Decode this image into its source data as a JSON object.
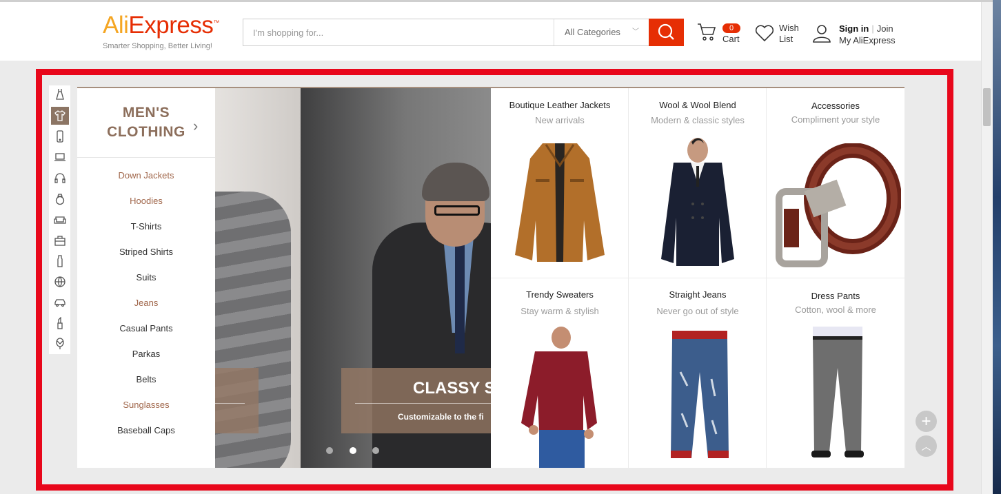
{
  "header": {
    "logo_ali": "Ali",
    "logo_express": "Express",
    "logo_tm": "™",
    "tagline": "Smarter Shopping, Better Living!",
    "search_placeholder": "I'm shopping for...",
    "category_select": "All Categories",
    "cart_count": "0",
    "cart_label": "Cart",
    "wish_line1": "Wish",
    "wish_line2": "List",
    "sign_in": "Sign in",
    "join": "Join",
    "my_account": "My AliExpress"
  },
  "category_rail": {
    "icons": [
      "dress-icon",
      "shirt-icon",
      "phone-icon",
      "laptop-icon",
      "headphones-icon",
      "ring-icon",
      "sofa-icon",
      "briefcase-icon",
      "bottle-icon",
      "ball-icon",
      "car-icon",
      "lipstick-icon",
      "balloon-icon"
    ],
    "active_index": 1
  },
  "category_panel": {
    "title_line1": "MEN'S",
    "title_line2": "CLOTHING",
    "items": [
      {
        "label": "Down Jackets",
        "highlight": true
      },
      {
        "label": "Hoodies",
        "highlight": true
      },
      {
        "label": "T-Shirts",
        "highlight": false
      },
      {
        "label": "Striped Shirts",
        "highlight": false
      },
      {
        "label": "Suits",
        "highlight": false
      },
      {
        "label": "Jeans",
        "highlight": true
      },
      {
        "label": "Casual Pants",
        "highlight": false
      },
      {
        "label": "Parkas",
        "highlight": false
      },
      {
        "label": "Belts",
        "highlight": false
      },
      {
        "label": "Sunglasses",
        "highlight": true
      },
      {
        "label": "Baseball Caps",
        "highlight": false
      }
    ]
  },
  "hero": {
    "caption_title": "CLASSY SU",
    "caption_sub": "Customizable to the fi",
    "slide_count": 3,
    "active_slide": 2
  },
  "products": [
    {
      "title": "Boutique Leather Jackets",
      "subtitle": "New arrivals",
      "icon": "jacket-image"
    },
    {
      "title": "Wool & Wool Blend",
      "subtitle": "Modern & classic styles",
      "icon": "coat-image"
    },
    {
      "title": "Accessories",
      "subtitle": "Compliment your style",
      "icon": "belt-image"
    },
    {
      "title": "Trendy Sweaters",
      "subtitle": "Stay warm & stylish",
      "icon": "sweater-image"
    },
    {
      "title": "Straight Jeans",
      "subtitle": "Never go out of style",
      "icon": "jeans-image"
    },
    {
      "title": "Dress Pants",
      "subtitle": "Cotton, wool & more",
      "icon": "pants-image"
    }
  ],
  "colors": {
    "brand": "#e62e04",
    "highlight_box": "#e8071b",
    "accent_brown": "#8c7564"
  }
}
